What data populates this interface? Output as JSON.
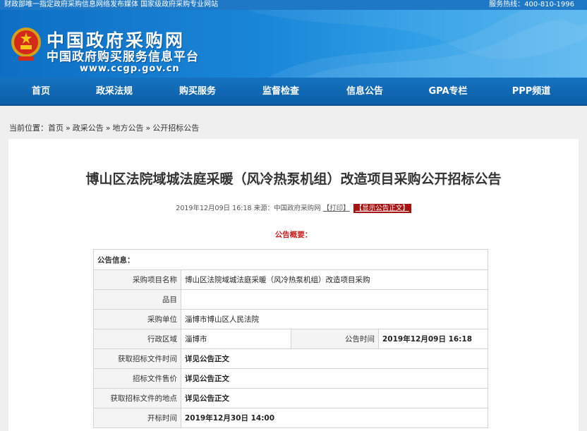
{
  "top_strip": {
    "left_text": "财政部唯一指定政府采购信息网络发布媒体 国家级政府采购专业网站",
    "hotline": "服务热线：400-810-1996"
  },
  "header": {
    "title": "中国政府采购网",
    "subtitle": "中国政府购买服务信息平台",
    "url": "www.ccgp.gov.cn",
    "logo_icon": "national-emblem-icon"
  },
  "nav": {
    "items": [
      "首页",
      "政采法规",
      "购买服务",
      "监督检查",
      "信息公告",
      "GPA专栏",
      "PPP频道"
    ]
  },
  "breadcrumb": {
    "prefix": "当前位置：",
    "items": [
      "首页",
      "政采公告",
      "地方公告",
      "公开招标公告"
    ],
    "separator": "»"
  },
  "article": {
    "title": "博山区法院域城法庭采暖（风冷热泵机组）改造项目采购公开招标公告",
    "datetime": "2019年12月09日 16:18",
    "source": "来源：中国政府采购网",
    "print_link": "【打印】",
    "show_full_button": "【显示公告正文】",
    "overview_label": "公告概要："
  },
  "info_table": {
    "header": "公告信息：",
    "rows": [
      {
        "label": "采购项目名称",
        "value": "博山区法院域城法庭采暖（风冷热泵机组）改造项目采购"
      },
      {
        "label": "品目",
        "value": ""
      },
      {
        "label": "采购单位",
        "value": "淄博市博山区人民法院"
      },
      {
        "label": "行政区域",
        "value": "淄博市",
        "label2": "公告时间",
        "value2": "2019年12月09日  16:18"
      },
      {
        "label": "获取招标文件时间",
        "value": "详见公告正文"
      },
      {
        "label": "招标文件售价",
        "value": "详见公告正文"
      },
      {
        "label": "获取招标文件的地点",
        "value": "详见公告正文"
      },
      {
        "label": "开标时间",
        "value": "2019年12月30日 14:00"
      }
    ]
  },
  "colors": {
    "nav_blue": "#0d5fa8",
    "banner_blue": "#1a86d8",
    "accent_red": "#a81212"
  }
}
